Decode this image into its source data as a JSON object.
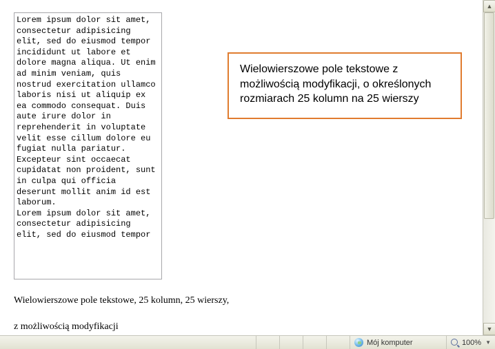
{
  "textarea": {
    "value": "Lorem ipsum dolor sit amet, consectetur adipisicing elit, sed do eiusmod tempor incididunt ut labore et dolore magna aliqua. Ut enim ad minim veniam, quis nostrud exercitation ullamco laboris nisi ut aliquip ex ea commodo consequat. Duis aute irure dolor in reprehenderit in voluptate velit esse cillum dolore eu fugiat nulla pariatur. Excepteur sint occaecat cupidatat non proident, sunt in culpa qui officia deserunt mollit anim id est laborum.\nLorem ipsum dolor sit amet, consectetur adipisicing elit, sed do eiusmod tempor"
  },
  "caption": {
    "line1": "Wielowierszowe pole tekstowe, 25 kolumn, 25 wierszy,",
    "line2": "z możliwością modyfikacji"
  },
  "annotation": {
    "text": "Wielowierszowe pole tekstowe z możliwością modyfikacji, o określonych rozmiarach 25 kolumn na 25 wierszy"
  },
  "statusbar": {
    "location": "Mój komputer",
    "zoom": "100%"
  }
}
